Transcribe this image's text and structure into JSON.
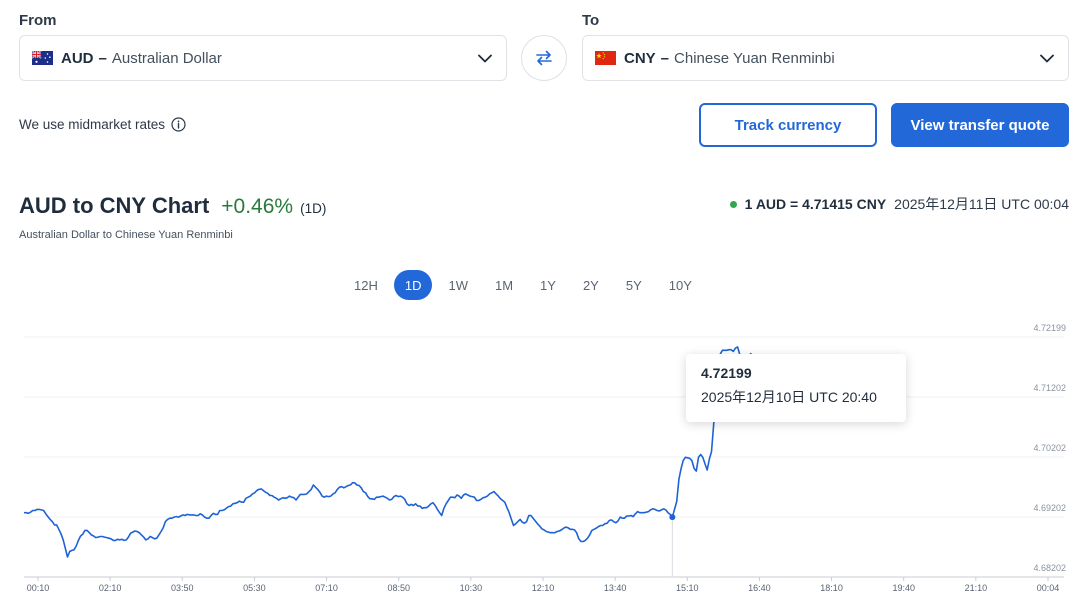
{
  "converter": {
    "from_label": "From",
    "to_label": "To",
    "from": {
      "code": "AUD",
      "separator": "–",
      "name": "Australian Dollar",
      "flag_icon": "australia-flag-icon"
    },
    "to": {
      "code": "CNY",
      "separator": "–",
      "name": "Chinese Yuan Renminbi",
      "flag_icon": "china-flag-icon"
    },
    "swap_icon": "swap-arrows-icon"
  },
  "info": {
    "midmarket_text": "We use midmarket rates"
  },
  "actions": {
    "track_label": "Track currency",
    "quote_label": "View transfer quote"
  },
  "header": {
    "title": "AUD to CNY Chart",
    "change": "+0.46%",
    "change_period": "(1D)",
    "subtitle": "Australian Dollar to Chinese Yuan Renminbi",
    "rate_text": "1 AUD = 4.71415 CNY",
    "rate_time": "2025年12月11日 UTC 00:04"
  },
  "periods": [
    "12H",
    "1D",
    "1W",
    "1M",
    "1Y",
    "2Y",
    "5Y",
    "10Y"
  ],
  "active_period": "1D",
  "colors": {
    "accent": "#2368d8",
    "positive": "#2b7a3b",
    "line": "#1e63d6",
    "live_dot": "#2fa84f"
  },
  "tooltip": {
    "value": "4.72199",
    "time": "2025年12月10日 UTC 20:40"
  },
  "chart_data": {
    "type": "line",
    "title": "",
    "xlabel": "",
    "ylabel": "",
    "grid": true,
    "x_ticks": [
      "00:10",
      "02:10",
      "03:50",
      "05:30",
      "07:10",
      "08:50",
      "10:30",
      "12:10",
      "13:40",
      "15:10",
      "16:40",
      "18:10",
      "19:40",
      "21:10",
      "00:04"
    ],
    "y_ticks": [
      "4.72199",
      "4.71202",
      "4.70202",
      "4.69202",
      "4.68202"
    ],
    "ylim": [
      4.6804,
      4.7237
    ],
    "x": [
      0,
      3,
      6,
      9,
      12,
      15,
      18,
      21,
      24,
      27,
      30,
      33,
      36,
      39,
      42,
      45,
      48,
      51,
      54,
      57,
      60,
      63,
      66,
      69,
      72,
      75,
      78,
      81,
      84,
      87,
      90,
      93,
      96,
      99,
      102,
      105,
      108,
      111,
      114,
      117,
      120,
      123,
      126,
      129,
      132,
      135,
      138,
      141,
      144,
      147,
      150,
      153,
      156,
      159,
      162,
      165,
      168,
      171,
      174,
      177,
      180,
      183,
      186,
      189,
      192,
      195,
      198,
      201,
      204,
      207,
      210,
      213,
      216,
      219,
      222,
      225,
      228,
      231,
      234,
      237,
      240,
      243,
      246,
      249,
      252,
      255,
      258,
      261,
      264,
      267,
      270,
      273,
      276,
      279,
      282,
      285,
      288,
      291,
      294,
      297,
      300,
      303,
      306,
      309,
      312,
      315,
      318,
      321,
      324,
      327,
      330,
      333,
      336,
      339,
      342,
      345,
      348,
      351,
      354,
      357,
      360,
      363,
      366,
      369,
      372,
      375,
      378,
      381,
      384,
      387,
      390,
      393,
      396,
      399,
      402,
      405,
      408,
      411,
      414,
      417,
      420,
      423,
      426,
      429,
      432,
      435,
      438,
      441,
      444,
      447,
      450,
      453,
      456,
      459,
      462,
      465,
      468,
      471,
      474,
      477,
      480,
      483,
      486,
      489,
      492,
      495,
      498,
      501,
      504,
      507,
      510,
      513,
      516,
      519,
      522,
      525,
      528,
      531,
      534,
      537,
      540,
      543,
      546,
      549,
      552,
      555,
      558,
      561,
      564,
      567,
      570,
      573,
      576,
      579,
      582,
      585,
      588,
      591,
      594,
      597,
      600,
      603,
      606,
      609,
      612,
      615,
      618,
      621,
      624,
      627,
      630,
      633,
      636,
      639,
      642,
      645,
      648,
      651,
      654,
      657,
      660,
      663,
      666,
      669,
      672,
      675,
      678,
      681,
      684,
      687,
      690,
      693,
      696,
      699,
      702,
      705,
      708,
      711,
      714,
      717,
      720,
      723,
      726,
      729,
      732,
      735,
      738,
      741,
      744,
      747,
      750,
      753,
      756,
      759,
      762,
      765,
      768,
      771,
      774,
      777,
      780,
      783,
      786,
      789,
      792,
      795,
      798,
      801,
      804,
      807,
      810,
      813,
      816,
      819,
      822,
      825,
      828,
      831,
      834,
      837,
      840,
      843,
      846,
      849,
      852,
      855,
      858,
      861,
      864,
      867,
      870,
      873,
      876,
      879,
      882,
      885,
      888,
      891,
      894,
      897,
      900,
      903,
      906,
      909,
      912,
      915,
      918,
      921,
      924,
      927,
      930,
      933,
      936,
      939,
      942,
      945,
      948,
      951,
      954,
      957,
      960,
      963,
      966,
      969,
      972,
      975,
      978,
      981,
      984,
      987,
      990,
      993,
      996,
      999,
      1002,
      1005,
      1008,
      1011,
      1014,
      1017,
      1020,
      1023,
      1026,
      1029,
      1032,
      1035,
      1038,
      1041,
      1044,
      1047,
      1050,
      1053,
      1056,
      1059,
      1062,
      1065,
      1068,
      1071,
      1074,
      1077,
      1080,
      1083,
      1086,
      1089,
      1092,
      1095,
      1098,
      1101,
      1104,
      1107,
      1110,
      1113,
      1116,
      1119,
      1122,
      1125,
      1128,
      1131,
      1134,
      1137,
      1140,
      1143,
      1146,
      1149,
      1152,
      1155,
      1158,
      1161,
      1164,
      1167,
      1170,
      1173,
      1176,
      1179,
      1182,
      1185,
      1188,
      1191,
      1194,
      1197,
      1200,
      1203,
      1206,
      1209,
      1212,
      1215,
      1218,
      1221,
      1224,
      1227,
      1230,
      1233,
      1236,
      1239,
      1242,
      1245,
      1248,
      1251,
      1254,
      1257,
      1260,
      1263,
      1266,
      1269,
      1272,
      1275,
      1278,
      1281,
      1284,
      1287,
      1290,
      1293,
      1296,
      1299,
      1302,
      1305,
      1308,
      1311,
      1314,
      1317,
      1320,
      1323,
      1326,
      1329,
      1332,
      1335,
      1338,
      1341,
      1344,
      1347,
      1350,
      1353,
      1356,
      1359,
      1362,
      1365,
      1368,
      1371,
      1374,
      1377,
      1380,
      1383,
      1386,
      1389,
      1392,
      1395,
      1398,
      1401,
      1404,
      1407,
      1410,
      1413,
      1416,
      1419,
      1422,
      1425,
      1428,
      1431,
      1434
    ],
    "values": [
      4.692,
      4.692,
      4.6919,
      4.6921,
      4.6924,
      4.6924,
      4.6926,
      4.6926,
      4.6925,
      4.6924,
      4.6918,
      4.6913,
      4.6908,
      4.6904,
      4.6898,
      4.6898,
      4.689,
      4.6882,
      4.6871,
      4.6856,
      4.684,
      4.685,
      4.6852,
      4.6853,
      4.686,
      4.687,
      4.6878,
      4.6881,
      4.6888,
      4.6888,
      4.6884,
      4.688,
      4.6878,
      4.6875,
      4.6876,
      4.6877,
      4.6877,
      4.6876,
      4.6875,
      4.6874,
      4.6873,
      4.687,
      4.687,
      4.6872,
      4.6871,
      4.6872,
      4.687,
      4.6871,
      4.6876,
      4.6883,
      4.6885,
      4.6887,
      4.6886,
      4.6884,
      4.688,
      4.6876,
      4.6871,
      4.6873,
      4.6877,
      4.6875,
      4.6873,
      4.6874,
      4.688,
      4.6886,
      4.6893,
      4.6904,
      4.6908,
      4.691,
      4.691,
      4.6912,
      4.6913,
      4.6912,
      4.6914,
      4.6916,
      4.6915,
      4.6917,
      4.6916,
      4.6916,
      4.6916,
      4.6915,
      4.6915,
      4.6918,
      4.6916,
      4.6912,
      4.691,
      4.691,
      4.6915,
      4.6919,
      4.6917,
      4.6917,
      4.6924,
      4.6924,
      4.6925,
      4.6928,
      4.6931,
      4.6932,
      4.6936,
      4.6937,
      4.6938,
      4.6941,
      4.6939,
      4.6939,
      4.6946,
      4.6948,
      4.695,
      4.6954,
      4.6956,
      4.696,
      4.6962,
      4.6963,
      4.696,
      4.6957,
      4.6955,
      4.6951,
      4.6951,
      4.6948,
      4.6946,
      4.6943,
      4.6945,
      4.6947,
      4.6946,
      4.6947,
      4.695,
      4.6948,
      4.6947,
      4.6943,
      4.6948,
      4.6953,
      4.6953,
      4.6953,
      4.6954,
      4.6958,
      4.6962,
      4.697,
      4.6966,
      4.6962,
      4.6957,
      4.695,
      4.6948,
      4.695,
      4.6949,
      4.695,
      4.6954,
      4.6956,
      4.6962,
      4.6966,
      4.6967,
      4.6965,
      4.6967,
      4.6969,
      4.697,
      4.6974,
      4.6974,
      4.697,
      4.6969,
      4.6965,
      4.6958,
      4.6956,
      4.6949,
      4.6945,
      4.6945,
      4.6944,
      4.6948,
      4.6948,
      4.6949,
      4.695,
      4.6948,
      4.6946,
      4.6943,
      4.6944,
      4.6949,
      4.6951,
      4.6949,
      4.695,
      4.6948,
      4.6944,
      4.6936,
      4.6933,
      4.6935,
      4.6933,
      4.6936,
      4.6932,
      4.6932,
      4.6928,
      4.6929,
      4.6929,
      4.6932,
      4.6936,
      4.6938,
      4.6933,
      4.6926,
      4.692,
      4.6915,
      4.6928,
      4.6936,
      4.6942,
      4.6948,
      4.6948,
      4.6947,
      4.6952,
      4.695,
      4.6946,
      4.6952,
      4.6954,
      4.6952,
      4.695,
      4.6949,
      4.6948,
      4.6942,
      4.6942,
      4.6944,
      4.6947,
      4.6948,
      4.695,
      4.6954,
      4.6956,
      4.6958,
      4.6954,
      4.695,
      4.6945,
      4.6942,
      4.6939,
      4.6929,
      4.692,
      4.6908,
      4.6897,
      4.69,
      4.6904,
      4.6908,
      4.6903,
      4.6901,
      4.6904,
      4.6915,
      4.6915,
      4.691,
      4.6905,
      4.69,
      4.6896,
      4.6891,
      4.6889,
      4.6886,
      4.6885,
      4.6884,
      4.6884,
      4.6884,
      4.6886,
      4.6887,
      4.6889,
      4.6892,
      4.6894,
      4.6893,
      4.689,
      4.689,
      4.6889,
      4.6884,
      4.6873,
      4.6868,
      4.6868,
      4.687,
      4.6874,
      4.688,
      4.6888,
      4.689,
      4.6892,
      4.6895,
      4.6897,
      4.6897,
      4.69,
      4.6901,
      4.6906,
      4.6907,
      4.6904,
      4.6902,
      4.6905,
      4.6912,
      4.691,
      4.691,
      4.6914,
      4.6914,
      4.6915,
      4.6913,
      4.6918,
      4.6922,
      4.692,
      4.692,
      4.692,
      4.6921,
      4.6922,
      4.6925,
      4.6927,
      4.6926,
      4.6924,
      4.6923,
      4.6925,
      4.6927,
      4.6925,
      4.692,
      4.6917,
      4.6912,
      4.6926,
      4.694,
      4.698,
      4.7,
      4.7014,
      4.702,
      4.7019,
      4.7018,
      4.7014,
      4.7,
      4.6995,
      4.702,
      4.7025,
      4.702,
      4.7008,
      4.6997,
      4.7017,
      4.703,
      4.708,
      4.713,
      4.7175,
      4.7206,
      4.7213,
      4.7213,
      4.7213,
      4.7214,
      4.7214,
      4.7211,
      4.7217,
      4.7219,
      4.7205,
      4.72,
      4.7198,
      4.7195,
      4.7197,
      4.7207,
      4.7202,
      4.7195,
      4.7186,
      4.7186,
      4.719,
      4.7192,
      4.719,
      4.7192,
      4.7194,
      4.7195,
      4.7196,
      4.7194,
      4.7191,
      4.719,
      4.7189,
      4.7185,
      4.7183,
      4.7182,
      4.7177,
      4.7175,
      4.7174,
      4.7172,
      4.7172,
      4.717,
      4.717,
      4.717,
      4.7169,
      4.7167,
      4.7166,
      4.7165,
      4.7162,
      4.7157,
      4.7158,
      4.7157,
      4.7156,
      4.7156,
      4.7158,
      4.716,
      4.7159,
      4.7156,
      4.716,
      4.7158,
      4.7158,
      4.7159,
      4.7162,
      4.717,
      4.7167,
      4.7165,
      4.716,
      4.716,
      4.7162,
      4.7163,
      4.716,
      4.7165,
      4.7167,
      4.7168,
      4.717,
      4.7168,
      4.7166,
      4.7162,
      4.716
    ],
    "tooltip_index": 298
  }
}
